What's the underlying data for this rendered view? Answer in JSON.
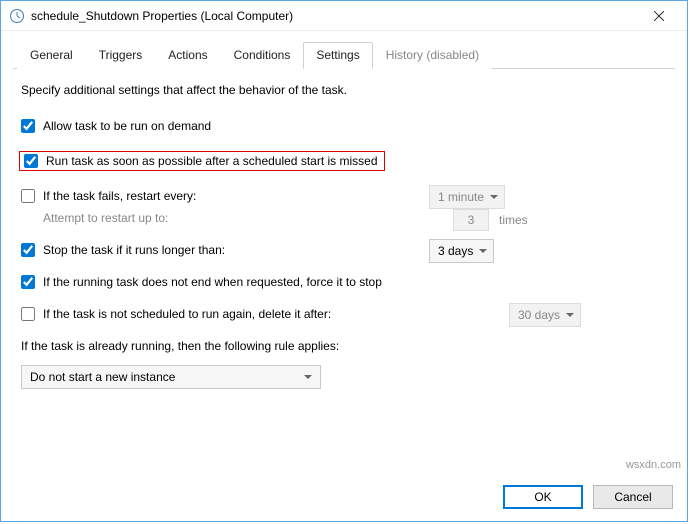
{
  "window": {
    "title": "schedule_Shutdown Properties (Local Computer)"
  },
  "tabs": {
    "general": "General",
    "triggers": "Triggers",
    "actions": "Actions",
    "conditions": "Conditions",
    "settings": "Settings",
    "history": "History (disabled)",
    "active": "settings"
  },
  "settings": {
    "intro": "Specify additional settings that affect the behavior of the task.",
    "allow_demand": {
      "label": "Allow task to be run on demand",
      "checked": true
    },
    "run_missed": {
      "label": "Run task as soon as possible after a scheduled start is missed",
      "checked": true
    },
    "restart_fail": {
      "label": "If the task fails, restart every:",
      "checked": false,
      "interval": "1 minute",
      "attempt_label": "Attempt to restart up to:",
      "attempt_count": "3",
      "attempt_unit": "times"
    },
    "stop_long": {
      "label": "Stop the task if it runs longer than:",
      "checked": true,
      "duration": "3 days"
    },
    "force_stop": {
      "label": "If the running task does not end when requested, force it to stop",
      "checked": true
    },
    "delete_after": {
      "label": "If the task is not scheduled to run again, delete it after:",
      "checked": false,
      "duration": "30 days"
    },
    "running_rule": {
      "label": "If the task is already running, then the following rule applies:",
      "value": "Do not start a new instance"
    }
  },
  "buttons": {
    "ok": "OK",
    "cancel": "Cancel"
  },
  "watermark": "wsxdn.com"
}
